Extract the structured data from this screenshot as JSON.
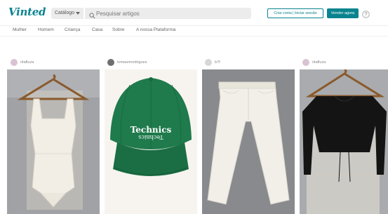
{
  "header": {
    "logo": "Vinted",
    "catalog_label": "Catálogo",
    "search_placeholder": "Pesquisar artigos",
    "signup_label": "Criar conta | Iniciar sessão",
    "sell_label": "Vender agora"
  },
  "nav": {
    "items": [
      {
        "label": "Mulher"
      },
      {
        "label": "Homem"
      },
      {
        "label": "Criança"
      },
      {
        "label": "Casa"
      },
      {
        "label": "Sobre"
      },
      {
        "label": "A nossa Plataforma"
      }
    ]
  },
  "colors": {
    "brand": "#09848f",
    "search_bg": "#ececec"
  },
  "feed": {
    "items": [
      {
        "username": "ritafluza",
        "photo": "white lace bodysuit on wooden hanger"
      },
      {
        "username": "tomasmrodrigues",
        "photo": "green Technics baseball cap"
      },
      {
        "username": "b7f",
        "photo": "white cropped wide-leg jeans"
      },
      {
        "username": "ritafluza",
        "photo": "black cropped top on hanger"
      }
    ]
  }
}
